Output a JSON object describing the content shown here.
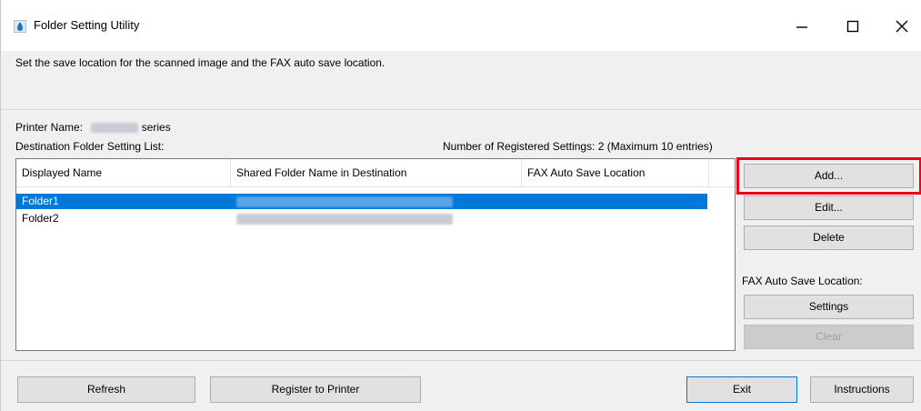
{
  "window": {
    "title": "Folder Setting Utility",
    "controls": {
      "minimize": "–",
      "maximize": "☐",
      "close": "✕"
    }
  },
  "description": "Set the save location for the scanned image and the FAX auto save location.",
  "printer": {
    "label": "Printer Name:",
    "suffix": "series"
  },
  "destination_list_label": "Destination Folder Setting List:",
  "registered_count": "Number of Registered Settings: 2 (Maximum 10 entries)",
  "table": {
    "columns": [
      "Displayed Name",
      "Shared Folder Name in Destination",
      "FAX Auto Save Location"
    ],
    "rows": [
      {
        "name": "Folder1",
        "fax": ""
      },
      {
        "name": "Folder2",
        "fax": ""
      }
    ]
  },
  "side_buttons": {
    "add": "Add...",
    "edit": "Edit...",
    "delete": "Delete"
  },
  "fax_section": {
    "label": "FAX Auto Save Location:",
    "settings": "Settings",
    "clear": "Clear"
  },
  "footer_buttons": {
    "refresh": "Refresh",
    "register": "Register to Printer",
    "exit": "Exit",
    "instructions": "Instructions"
  },
  "colors": {
    "selection": "#0078d7",
    "highlight": "#e8001c",
    "window_bg": "#f0f0f0"
  }
}
